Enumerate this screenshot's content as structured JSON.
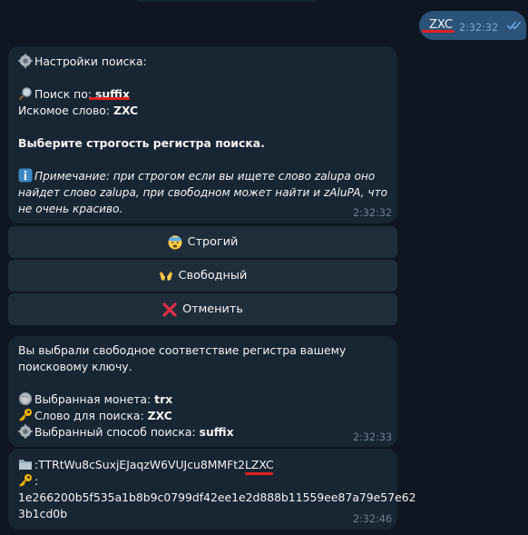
{
  "outgoing": {
    "text": "ZXC",
    "time": "2:32:32"
  },
  "msg1": {
    "heading": "Настройки поиска:",
    "search_by_label": "Поиск по: ",
    "search_by_value": "suffix",
    "word_label": "Искомое слово: ",
    "word_value": "ZXC",
    "prompt": "Выберите строгость регистра поиска.",
    "note_label": "Примечание:",
    "note_line1": " при строгом если вы ищете слово zalupa оно",
    "note_line2": "найдет слово zalupa, при свободном может найти и zAluPA, что",
    "note_line3": "не очень красиво.",
    "time": "2:32:32"
  },
  "buttons": [
    {
      "label": "Строгий",
      "icon": "fearful-face-icon"
    },
    {
      "label": "Свободный",
      "icon": "open-hands-icon"
    },
    {
      "label": "Отменить",
      "icon": "cross-mark-icon"
    }
  ],
  "msg2": {
    "line1": "Вы выбрали свободное соответствие регистра вашему",
    "line2": "поисковому ключу.",
    "coin_label": "Выбранная монета: ",
    "coin_value": "trx",
    "word_label": "Слово для поиска: ",
    "word_value": "ZXC",
    "method_label": "Выбранный способ поиска: ",
    "method_value": "suffix",
    "time": "2:32:33"
  },
  "msg3": {
    "address": ":TTRtWu8cSuxjEJaqzW6VUJcu8MMFt2LZXC",
    "key_label": ":",
    "key_line1": "1e266200b5f535a1b8b9c0799df42ee1e2d888b11559ee87a79e57e62",
    "key_line2": "3b1cd0b",
    "time": "2:32:46"
  },
  "colors": {
    "background": "#0e1621",
    "incoming": "#182533",
    "outgoing": "#2b5278",
    "annotation": "#e0211d"
  }
}
